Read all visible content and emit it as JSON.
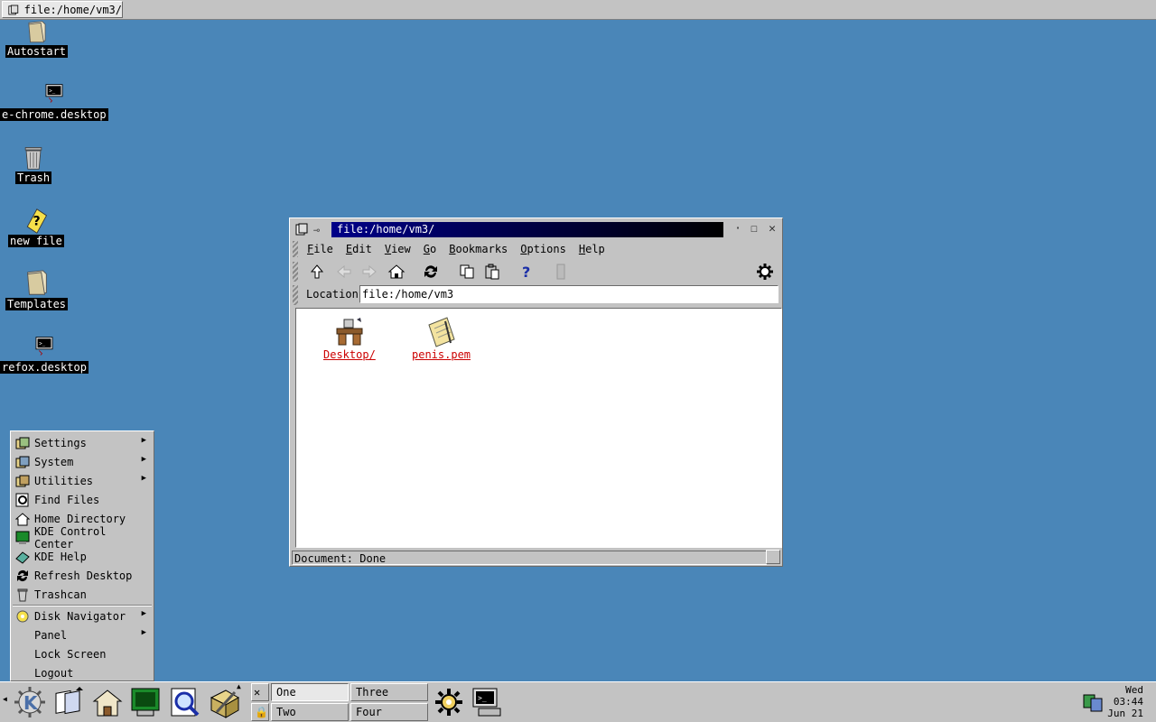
{
  "top_bar": {
    "task_title": "file:/home/vm3/"
  },
  "desktop_icons": [
    {
      "label": "Autostart",
      "icon": "folder-icon"
    },
    {
      "label": "e-chrome.desktop",
      "icon": "terminal-icon"
    },
    {
      "label": "Trash",
      "icon": "trash-icon"
    },
    {
      "label": "new file",
      "icon": "help-file-icon"
    },
    {
      "label": "Templates",
      "icon": "folder-icon"
    },
    {
      "label": "refox.desktop",
      "icon": "terminal-icon"
    }
  ],
  "window": {
    "title": "file:/home/vm3/",
    "menus": [
      {
        "label": "File",
        "u": "F",
        "rest": "ile"
      },
      {
        "label": "Edit",
        "u": "E",
        "rest": "dit"
      },
      {
        "label": "View",
        "u": "V",
        "rest": "iew"
      },
      {
        "label": "Go",
        "u": "G",
        "rest": "o"
      },
      {
        "label": "Bookmarks",
        "u": "B",
        "rest": "ookmarks"
      },
      {
        "label": "Options",
        "u": "O",
        "rest": "ptions"
      },
      {
        "label": "Help",
        "u": "H",
        "rest": "elp"
      }
    ],
    "toolbar": [
      "up-arrow-icon",
      "back-arrow-icon",
      "forward-arrow-icon",
      "home-icon",
      "reload-icon",
      "copy-icon",
      "paste-icon",
      "help-icon",
      "stop-icon",
      "gear-icon"
    ],
    "location_label": "Location:",
    "location_value": "file:/home/vm3",
    "files": [
      {
        "name": "Desktop/",
        "icon": "desktop-folder-icon"
      },
      {
        "name": "penis.pem",
        "icon": "text-file-icon"
      }
    ],
    "status": "Document: Done"
  },
  "start_menu": {
    "items": [
      {
        "label": "Settings",
        "icon": "settings-icon",
        "submenu": true
      },
      {
        "label": "System",
        "icon": "system-icon",
        "submenu": true
      },
      {
        "label": "Utilities",
        "icon": "utilities-icon",
        "submenu": true
      },
      {
        "label": "Find Files",
        "icon": "find-icon",
        "submenu": false
      },
      {
        "label": "Home Directory",
        "icon": "home-icon",
        "submenu": false
      },
      {
        "label": "KDE Control Center",
        "icon": "control-center-icon",
        "submenu": false
      },
      {
        "label": "KDE Help",
        "icon": "kde-help-icon",
        "submenu": false
      },
      {
        "label": "Refresh Desktop",
        "icon": "refresh-icon",
        "submenu": false
      },
      {
        "label": "Trashcan",
        "icon": "trash-icon",
        "submenu": false
      },
      {
        "label": "Disk Navigator",
        "icon": "disk-navigator-icon",
        "submenu": true
      },
      {
        "label": "Panel",
        "icon": "",
        "submenu": true
      },
      {
        "label": "Lock Screen",
        "icon": "",
        "submenu": false
      },
      {
        "label": "Logout",
        "icon": "",
        "submenu": false
      }
    ]
  },
  "panel": {
    "desktops": [
      "One",
      "Two",
      "Three",
      "Four"
    ],
    "active_desktop": "One",
    "clock": {
      "day": "Wed",
      "time": "03:44",
      "date": "Jun 21"
    }
  }
}
